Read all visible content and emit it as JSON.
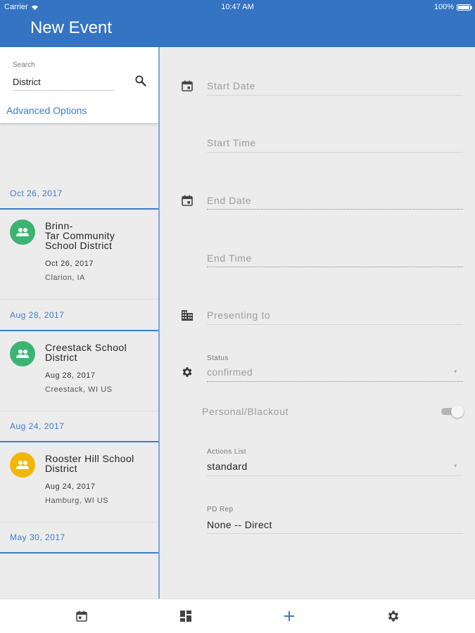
{
  "status_bar": {
    "carrier": "Carrier",
    "time": "10:47 AM",
    "battery": "100%"
  },
  "app": {
    "title": "New Event",
    "accent_color": "#3474c2"
  },
  "search": {
    "label": "Search",
    "value": "District",
    "advanced_options": "Advanced Options"
  },
  "event_groups": [
    {
      "date_header": "Oct 26, 2017",
      "events": [
        {
          "title": "Brinn-\nTar Community\nSchool District",
          "date": "Oct 26, 2017",
          "location": "Clarion, IA",
          "avatar_color": "#3cb371",
          "icon": "group-icon"
        }
      ]
    },
    {
      "date_header": "Aug 28, 2017",
      "events": [
        {
          "title": "Creestack School\nDistrict",
          "date": "Aug 28, 2017",
          "location": "Creestack, WI US",
          "avatar_color": "#3cb371",
          "icon": "group-icon"
        }
      ]
    },
    {
      "date_header": "Aug 24, 2017",
      "events": [
        {
          "title": "Rooster Hill School\nDistrict",
          "date": "Aug 24, 2017",
          "location": "Hamburg, WI US",
          "avatar_color": "#f2b705",
          "icon": "group-icon"
        }
      ]
    },
    {
      "date_header": "May 30, 2017",
      "events": []
    }
  ],
  "form": {
    "start_date": {
      "placeholder": "Start Date",
      "icon": "calendar-icon"
    },
    "start_time": {
      "placeholder": "Start Time"
    },
    "end_date": {
      "placeholder": "End Date",
      "icon": "calendar-icon"
    },
    "end_time": {
      "placeholder": "End Time"
    },
    "presenting_to": {
      "placeholder": "Presenting to",
      "icon": "building-icon"
    },
    "status": {
      "label": "Status",
      "value": "confirmed",
      "icon": "gear-icon"
    },
    "personal_blackout": {
      "label": "Personal/Blackout",
      "checked": false
    },
    "actions_list": {
      "label": "Actions List",
      "value": "standard"
    },
    "pd_rep": {
      "label": "PD Rep",
      "value": "None -- Direct"
    }
  },
  "bottom_tabs": [
    {
      "name": "calendar-tab",
      "icon": "calendar-icon"
    },
    {
      "name": "dashboard-tab",
      "icon": "dashboard-icon"
    },
    {
      "name": "add-tab",
      "icon": "plus-icon"
    },
    {
      "name": "settings-tab",
      "icon": "gear-icon"
    }
  ]
}
